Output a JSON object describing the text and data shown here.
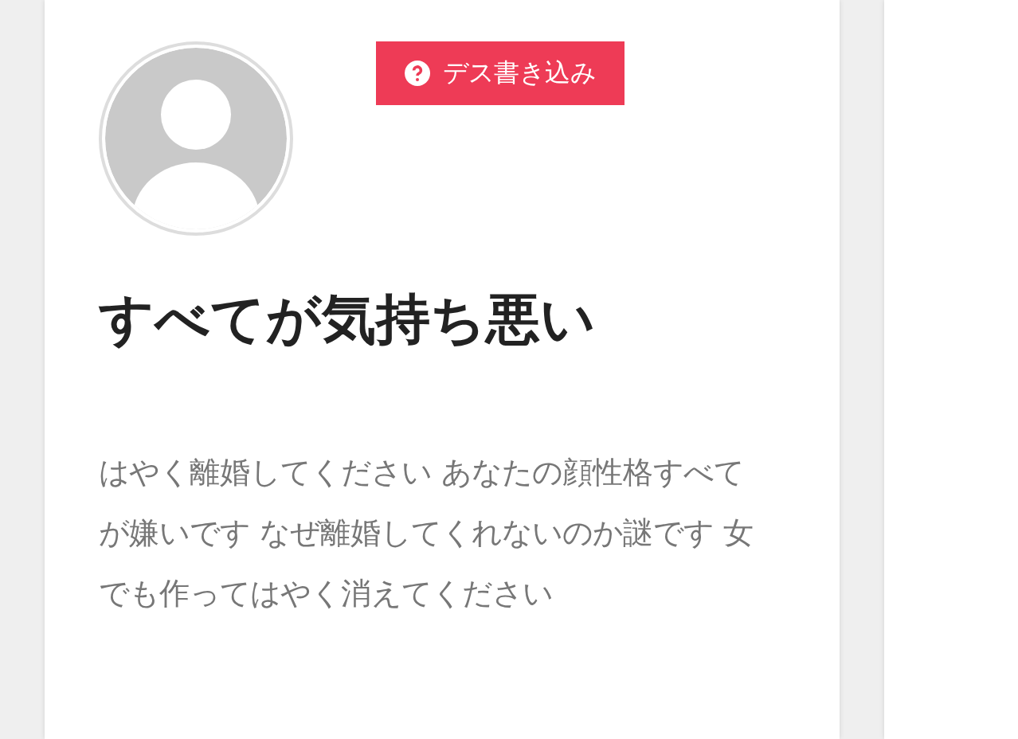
{
  "profile": {
    "action_button": {
      "label": "デス書き込み"
    }
  },
  "post": {
    "title": "すべてが気持ち悪い",
    "body": "はやく離婚してください あなたの顔性格すべてが嫌いです なぜ離婚してくれないのか謎です 女でも作ってはやく消えてください"
  }
}
